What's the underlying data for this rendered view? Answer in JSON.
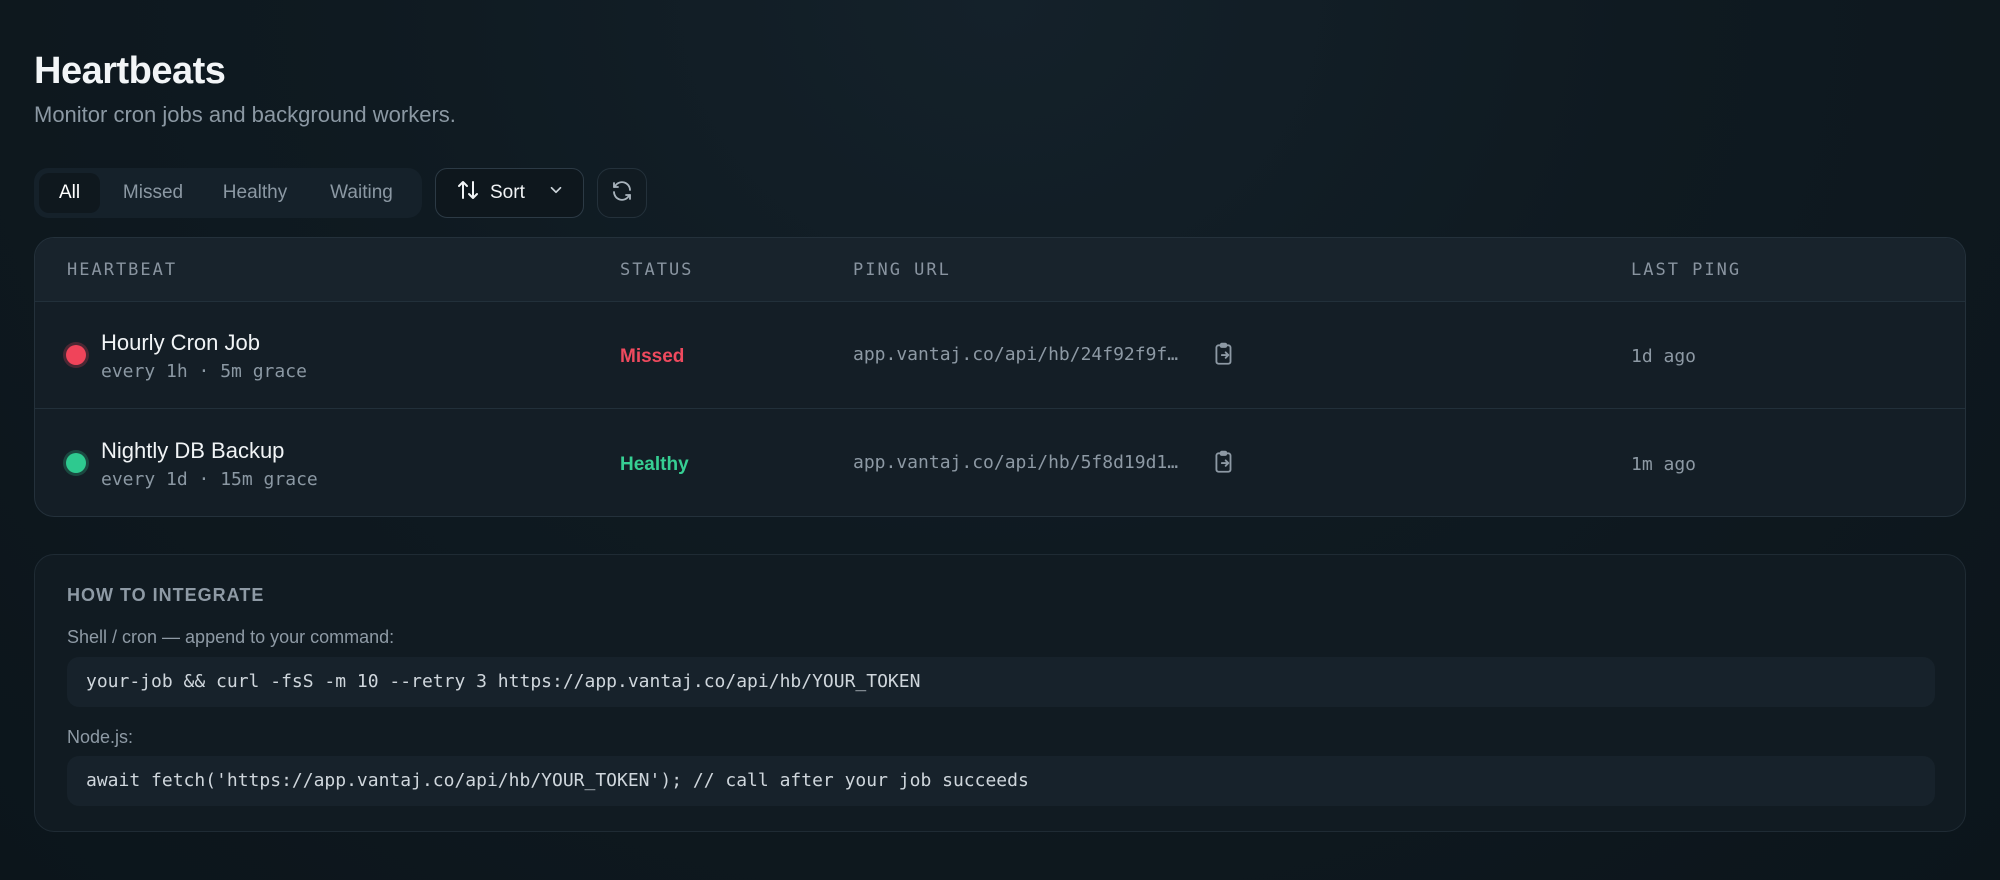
{
  "header": {
    "title": "Heartbeats",
    "subtitle": "Monitor cron jobs and background workers."
  },
  "toolbar": {
    "filters": [
      {
        "label": "All",
        "active": true
      },
      {
        "label": "Missed",
        "active": false
      },
      {
        "label": "Healthy",
        "active": false
      },
      {
        "label": "Waiting",
        "active": false
      }
    ],
    "sort_label": "Sort",
    "sort_icon": "sort-arrows-icon",
    "refresh_icon": "refresh-icon"
  },
  "table": {
    "columns": [
      "HEARTBEAT",
      "STATUS",
      "PING URL",
      "LAST PING"
    ],
    "rows": [
      {
        "name": "Hourly Cron Job",
        "meta": "every 1h · 5m grace",
        "status": "Missed",
        "status_color": "#ef4a5e",
        "ping_url": "app.vantaj.co/api/hb/24f92f9f…",
        "last_ping": "1d ago"
      },
      {
        "name": "Nightly DB Backup",
        "meta": "every 1d · 15m grace",
        "status": "Healthy",
        "status_color": "#36cf93",
        "ping_url": "app.vantaj.co/api/hb/5f8d19d1…",
        "last_ping": "1m ago"
      }
    ]
  },
  "integrate": {
    "title": "HOW TO INTEGRATE",
    "shell_label": "Shell / cron — append to your command:",
    "shell_code": "your-job && curl -fsS -m 10 --retry 3 https://app.vantaj.co/api/hb/YOUR_TOKEN",
    "node_label": "Node.js:",
    "node_code": "await fetch('https://app.vantaj.co/api/hb/YOUR_TOKEN'); // call after your job succeeds"
  }
}
